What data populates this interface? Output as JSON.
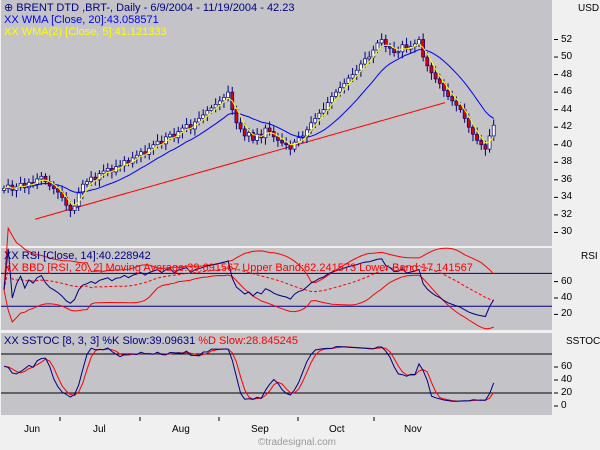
{
  "header": {
    "icon": "instrument-icon",
    "title": "BRENT DTD ,BRT-, Daily - 6/9/2004 - 11/19/2004 - 42.23",
    "wma20_label": "WMA [Close, 20]:43.058571",
    "wma5_label": "WMA(2) [Close, 5]:41.121333",
    "rsi_label": "RSI [Close, 14]:40.228942",
    "bbd_label": "BBD [RSI, 20, 2] Moving Average:39.691567 Upper Band:62.241573 Lower Band:17.141567",
    "sstoc_label": "SSTOC [8, 3, 3]",
    "k_label": "%K Slow:39.09631",
    "d_label": "%D Slow:28.845245",
    "marker": "XX"
  },
  "axes": {
    "price_unit": "USD",
    "price_ticks": [
      "52",
      "50",
      "48",
      "46",
      "44",
      "42",
      "40",
      "38",
      "36",
      "34",
      "32",
      "30"
    ],
    "rsi_title": "RSI",
    "rsi_ticks": [
      "60",
      "40",
      "20"
    ],
    "sstoc_title": "SSTOC",
    "sstoc_ticks": [
      "60",
      "40",
      "20",
      "0"
    ],
    "months": [
      "Jun",
      "Jul",
      "Aug",
      "Sep",
      "Oct",
      "Nov"
    ]
  },
  "watermark": "©tradesignal.com",
  "colors": {
    "panel": "#c4c3c8",
    "candle_up": "#ffffff",
    "candle_down": "#e00000",
    "outline": "#000080",
    "wma20": "#0000ff",
    "wma5": "#ffff00",
    "trend": "#ff0000",
    "rsi": "#000080",
    "bands": "#ff0000"
  },
  "chart_data": {
    "type": "candlestick",
    "start_date": "6/9/2004",
    "end_date": "11/19/2004",
    "ylim": [
      29,
      54
    ],
    "close": [
      35.0,
      35.4,
      34.8,
      35.2,
      35.6,
      35.1,
      35.7,
      35.5,
      36.1,
      36.4,
      35.8,
      35.3,
      35.0,
      34.6,
      34.0,
      33.1,
      32.5,
      33.0,
      34.5,
      35.5,
      35.8,
      36.3,
      36.0,
      36.7,
      37.0,
      37.3,
      36.9,
      37.5,
      37.6,
      38.2,
      37.9,
      38.5,
      38.8,
      39.2,
      38.9,
      39.6,
      40.0,
      40.4,
      40.1,
      40.9,
      41.2,
      40.8,
      41.5,
      41.9,
      42.3,
      41.8,
      42.6,
      43.0,
      43.4,
      43.9,
      44.2,
      44.6,
      45.0,
      45.4,
      46.0,
      44.0,
      42.5,
      41.8,
      41.0,
      41.4,
      40.5,
      41.2,
      40.8,
      41.9,
      41.5,
      40.9,
      40.5,
      40.2,
      40.0,
      39.5,
      40.3,
      40.8,
      41.0,
      41.7,
      42.5,
      43.0,
      43.6,
      44.0,
      44.8,
      45.5,
      46.0,
      46.5,
      47.0,
      47.6,
      48.0,
      48.5,
      49.2,
      49.8,
      50.0,
      50.8,
      51.6,
      52.0,
      51.2,
      51.0,
      50.5,
      50.6,
      51.4,
      50.9,
      51.2,
      51.5,
      52.0,
      50.0,
      49.0,
      48.2,
      47.5,
      47.0,
      46.2,
      45.5,
      45.0,
      44.5,
      44.0,
      43.0,
      42.0,
      41.2,
      40.5,
      40.0,
      39.5,
      41.0,
      42.23
    ],
    "trendline": {
      "from_price": 31.5,
      "to_price": 44.8
    },
    "rsi_levels": [
      70,
      30
    ],
    "sstoc_levels": [
      80,
      20
    ]
  }
}
